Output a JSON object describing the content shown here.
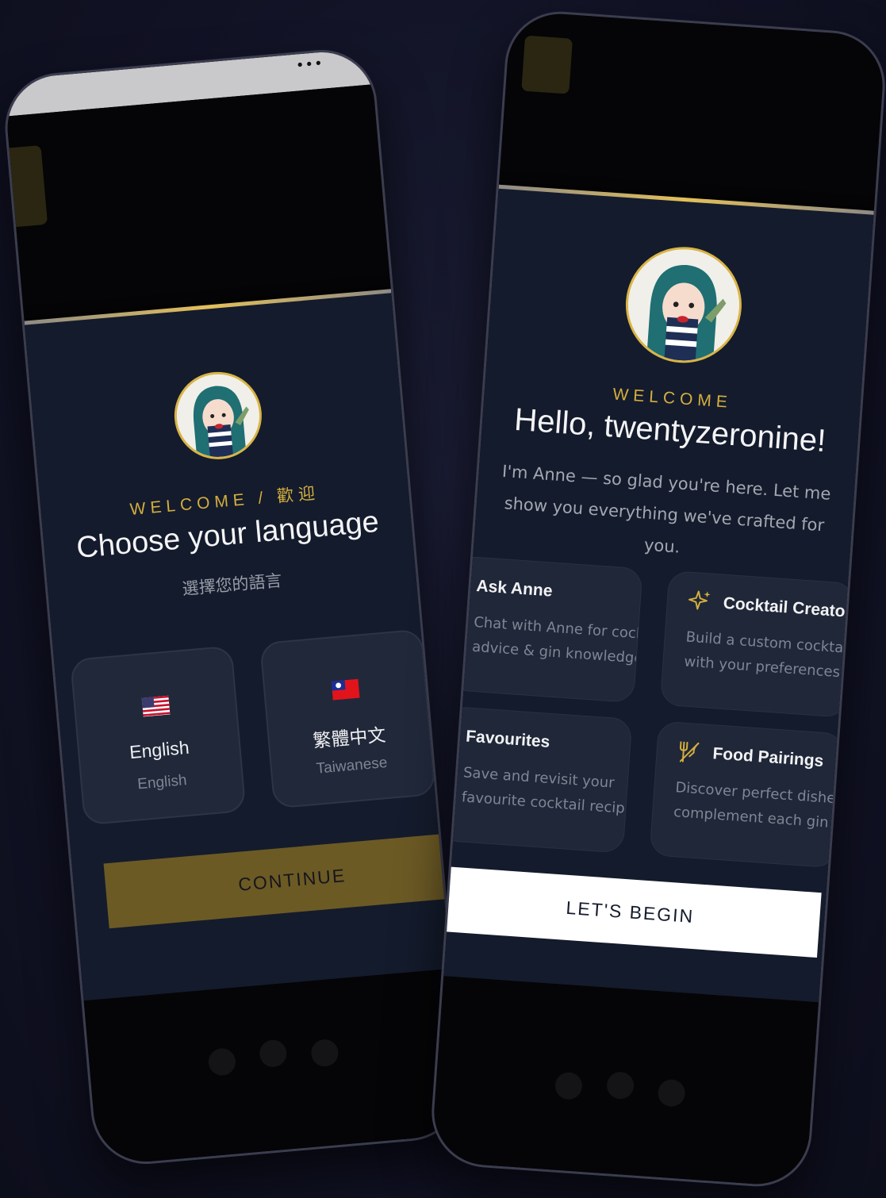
{
  "language_screen": {
    "eyebrow": "WELCOME / 歡迎",
    "title": "Choose your language",
    "subtitle": "選擇您的語言",
    "languages": [
      {
        "flag": "us-flag-icon",
        "name": "English",
        "native": "English"
      },
      {
        "flag": "tw-flag-icon",
        "name": "繁體中文",
        "native": "Taiwanese"
      }
    ],
    "continue_label": "CONTINUE"
  },
  "welcome_screen": {
    "eyebrow": "WELCOME",
    "title": "Hello, twentyzeronine!",
    "intro": "I'm Anne — so glad you're here. Let me show you everything we've crafted for you.",
    "features": [
      {
        "icon": "",
        "title": "Ask Anne",
        "desc": "Chat with Anne for cocktail advice & gin knowledge"
      },
      {
        "icon": "sparkle-icon",
        "title": "Cocktail Creator",
        "desc": "Build a custom cocktail with your preferences"
      },
      {
        "icon": "",
        "title": "Favourites",
        "desc": "Save and revisit your favourite cocktail recipes"
      },
      {
        "icon": "utensils-icon",
        "title": "Food Pairings",
        "desc": "Discover perfect dishes to complement each gin"
      }
    ],
    "begin_label": "LET'S BEGIN"
  },
  "colors": {
    "accent_gold": "#d4ae3e",
    "sheet_bg": "#141b2c",
    "card_bg": "#1f2738"
  }
}
